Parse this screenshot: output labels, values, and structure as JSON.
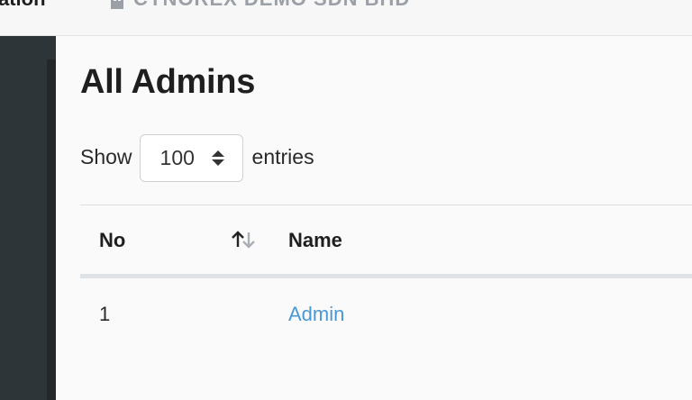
{
  "header": {
    "app_name": "ation",
    "company": "CYNOREX DEMO SDN BHD"
  },
  "page": {
    "title": "All Admins"
  },
  "length_control": {
    "show_label": "Show",
    "selected": "100",
    "entries_label": "entries"
  },
  "table": {
    "columns": [
      "No",
      "Name"
    ],
    "rows": [
      {
        "no": "1",
        "name": "Admin"
      }
    ]
  },
  "colors": {
    "sidebar": "#2e3538",
    "link": "#4a98d4",
    "header_border": "#dfe3e8"
  }
}
